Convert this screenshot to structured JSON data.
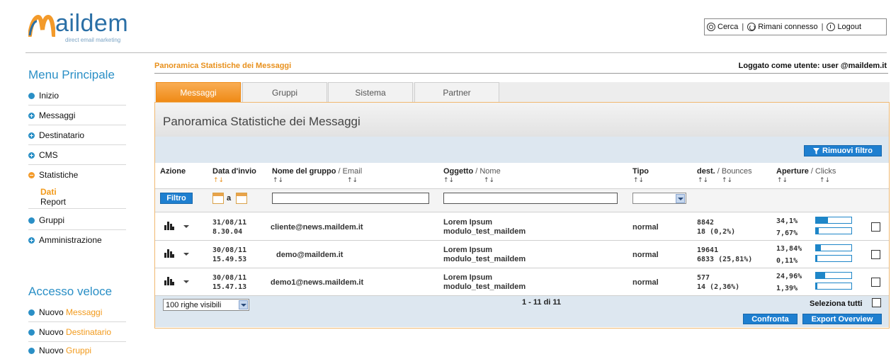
{
  "brand": {
    "logo_word": "aildem",
    "logo_tagline": "direct email marketing"
  },
  "toolbar": {
    "search": "Cerca",
    "stay": "Rimani connesso",
    "logout": "Logout",
    "sep": "|"
  },
  "sidebar": {
    "menu_title": "Menu Principale",
    "items": [
      {
        "label": "Inizio",
        "icon": "bullet-icon"
      },
      {
        "label": "Messaggi",
        "icon": "plus-circle-icon"
      },
      {
        "label": "Destinatario",
        "icon": "plus-circle-icon"
      },
      {
        "label": "CMS",
        "icon": "plus-circle-icon"
      },
      {
        "label": "Statistiche",
        "icon": "minus-circle-icon"
      },
      {
        "label": "Gruppi",
        "icon": "bullet-icon"
      },
      {
        "label": "Amministrazione",
        "icon": "plus-circle-icon"
      }
    ],
    "sub_items": [
      "Dati",
      "Report"
    ],
    "quick_title": "Accesso veloce",
    "quick": [
      {
        "prefix": "Nuovo",
        "label": "Messaggi"
      },
      {
        "prefix": "Nuovo",
        "label": "Destinatario"
      },
      {
        "prefix": "Nuovo",
        "label": "Gruppi"
      }
    ]
  },
  "main": {
    "breadcrumb": "Panoramica Statistiche dei Messaggi",
    "logged_as": "Loggato come utente: user @maildem.it",
    "tabs": [
      "Messaggi",
      "Gruppi",
      "Sistema",
      "Partner"
    ],
    "active_tab": "Messaggi",
    "panel_title": "Panoramica Statistiche dei Messaggi",
    "remove_filter": "Rimuovi filtro",
    "filter_button": "Filtro",
    "date_sep": "a",
    "headers": {
      "azione": "Azione",
      "data": "Data d'invio",
      "gruppo": "Nome del gruppo",
      "email": "/ Email",
      "oggetto": "Oggetto",
      "nome": "/ Nome",
      "tipo": "Tipo",
      "dest": "dest.",
      "bounces": "/ Bounces",
      "aperture": "Aperture",
      "clicks": "/ Clicks",
      "sort_glyph": "↑↓"
    },
    "rows": [
      {
        "date": "31/08/11",
        "time": "8.30.04",
        "email": "cliente@news.maildem.it",
        "subject": "Lorem Ipsum",
        "name": "modulo_test_maildem",
        "type": "normal",
        "dest": "8842",
        "bounces": "18  (0,2%)",
        "opens": "34,1%",
        "clicks": "7,67%",
        "opens_frac": 0.341,
        "clicks_frac": 0.077
      },
      {
        "date": "30/08/11",
        "time": "15.49.53",
        "email": "demo@maildem.it",
        "subject": "Lorem Ipsum",
        "name": "modulo_test_maildem",
        "type": "normal",
        "dest": "19641",
        "bounces": "6833  (25,81%)",
        "opens": "13,84%",
        "clicks": "0,11%",
        "opens_frac": 0.138,
        "clicks_frac": 0.011
      },
      {
        "date": "30/08/11",
        "time": "15.47.13",
        "email": "demo1@news.maildem.it",
        "subject": "Lorem Ipsum",
        "name": "modulo_test_maildem",
        "type": "normal",
        "dest": "577",
        "bounces": "14  (2,36%)",
        "opens": "24,96%",
        "clicks": "1,39%",
        "opens_frac": 0.25,
        "clicks_frac": 0.014
      }
    ],
    "rows_visible": "100 righe visibili",
    "pagination": "1 - 11 di 11",
    "select_all": "Seleziona tutti",
    "compare": "Confronta",
    "export": "Export Overview"
  },
  "colors": {
    "accent_orange": "#ef8a15",
    "accent_blue": "#1e7fd0",
    "menu_blue": "#2a8fc6"
  }
}
